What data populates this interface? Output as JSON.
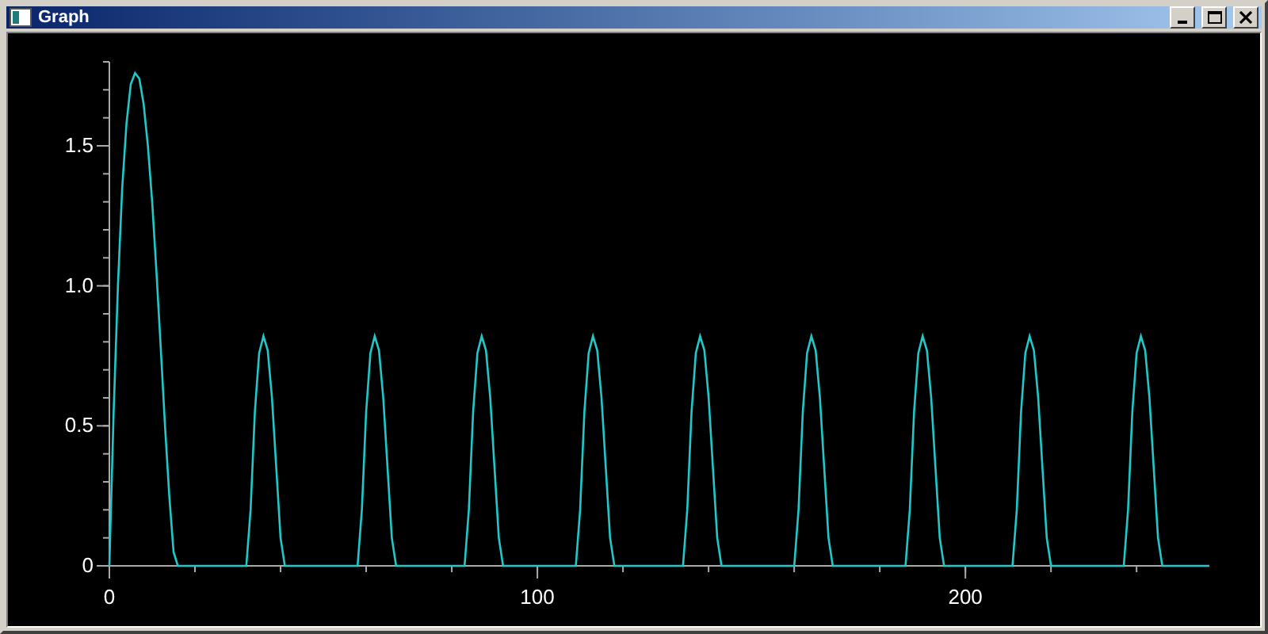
{
  "window": {
    "title": "Graph"
  },
  "graph": {
    "chart_data": {
      "type": "line",
      "xlim": [
        0,
        257
      ],
      "ylim": [
        0,
        1.8
      ],
      "xticks": [
        0,
        100,
        200
      ],
      "yticks": [
        0,
        {
          "value": 0.5,
          "label": "0.5"
        },
        {
          "value": 1,
          "label": "1.0"
        },
        {
          "value": 1.5,
          "label": "1.5"
        }
      ],
      "x": [
        0,
        1,
        2,
        3,
        4,
        5,
        6,
        7,
        8,
        9,
        10,
        11,
        12,
        13,
        14,
        15,
        16,
        17,
        18,
        19,
        20,
        21,
        22,
        23,
        24,
        25,
        26,
        27,
        28,
        29,
        30,
        31,
        32,
        33,
        34,
        35,
        36,
        37,
        38,
        39,
        40,
        41,
        42,
        43,
        44,
        45,
        46,
        47,
        48,
        49,
        50,
        51,
        52,
        53,
        54,
        55,
        56,
        57,
        58,
        59,
        60,
        61,
        62,
        63,
        64,
        65,
        66,
        67,
        68,
        69,
        70,
        71,
        72,
        73,
        74,
        75,
        76,
        77,
        78,
        79,
        80,
        81,
        82,
        83,
        84,
        85,
        86,
        87,
        88,
        89,
        90,
        91,
        92,
        93,
        94,
        95,
        96,
        97,
        98,
        99,
        100,
        101,
        102,
        103,
        104,
        105,
        106,
        107,
        108,
        109,
        110,
        111,
        112,
        113,
        114,
        115,
        116,
        117,
        118,
        119,
        120,
        121,
        122,
        123,
        124,
        125,
        126,
        127,
        128,
        129,
        130,
        131,
        132,
        133,
        134,
        135,
        136,
        137,
        138,
        139,
        140,
        141,
        142,
        143,
        144,
        145,
        146,
        147,
        148,
        149,
        150,
        151,
        152,
        153,
        154,
        155,
        156,
        157,
        158,
        159,
        160,
        161,
        162,
        163,
        164,
        165,
        166,
        167,
        168,
        169,
        170,
        171,
        172,
        173,
        174,
        175,
        176,
        177,
        178,
        179,
        180,
        181,
        182,
        183,
        184,
        185,
        186,
        187,
        188,
        189,
        190,
        191,
        192,
        193,
        194,
        195,
        196,
        197,
        198,
        199,
        200,
        201,
        202,
        203,
        204,
        205,
        206,
        207,
        208,
        209,
        210,
        211,
        212,
        213,
        214,
        215,
        216,
        217,
        218,
        219,
        220,
        221,
        222,
        223,
        224,
        225,
        226,
        227,
        228,
        229,
        230,
        231,
        232,
        233,
        234,
        235,
        236,
        237,
        238,
        239,
        240,
        241,
        242,
        243,
        244,
        245,
        246,
        247,
        248,
        249,
        250,
        251,
        252,
        253,
        254,
        255,
        256,
        257
      ],
      "series": [
        {
          "color": "#20c8c8",
          "values": [
            0,
            0.55,
            1,
            1.35,
            1.58,
            1.72,
            1.76,
            1.74,
            1.65,
            1.5,
            1.3,
            1.05,
            0.78,
            0.5,
            0.25,
            0.05,
            0,
            0,
            0,
            0,
            0,
            0,
            0,
            0,
            0,
            0,
            0,
            0,
            0,
            0,
            0,
            0,
            0,
            0.2,
            0.55,
            0.76,
            0.82,
            0.77,
            0.6,
            0.35,
            0.1,
            0,
            0,
            0,
            0,
            0,
            0,
            0,
            0,
            0,
            0,
            0,
            0,
            0,
            0,
            0,
            0,
            0,
            0,
            0.2,
            0.55,
            0.76,
            0.82,
            0.77,
            0.6,
            0.35,
            0.1,
            0,
            0,
            0,
            0,
            0,
            0,
            0,
            0,
            0,
            0,
            0,
            0,
            0,
            0,
            0,
            0,
            0,
            0.2,
            0.55,
            0.76,
            0.82,
            0.77,
            0.6,
            0.35,
            0.1,
            0,
            0,
            0,
            0,
            0,
            0,
            0,
            0,
            0,
            0,
            0,
            0,
            0,
            0,
            0,
            0,
            0,
            0,
            0.2,
            0.55,
            0.76,
            0.82,
            0.77,
            0.6,
            0.35,
            0.1,
            0,
            0,
            0,
            0,
            0,
            0,
            0,
            0,
            0,
            0,
            0,
            0,
            0,
            0,
            0,
            0,
            0,
            0.2,
            0.55,
            0.76,
            0.82,
            0.77,
            0.6,
            0.35,
            0.1,
            0,
            0,
            0,
            0,
            0,
            0,
            0,
            0,
            0,
            0,
            0,
            0,
            0,
            0,
            0,
            0,
            0,
            0,
            0.2,
            0.55,
            0.76,
            0.82,
            0.77,
            0.6,
            0.35,
            0.1,
            0,
            0,
            0,
            0,
            0,
            0,
            0,
            0,
            0,
            0,
            0,
            0,
            0,
            0,
            0,
            0,
            0,
            0,
            0.2,
            0.55,
            0.76,
            0.82,
            0.77,
            0.6,
            0.35,
            0.1,
            0,
            0,
            0,
            0,
            0,
            0,
            0,
            0,
            0,
            0,
            0,
            0,
            0,
            0,
            0,
            0,
            0,
            0.2,
            0.55,
            0.76,
            0.82,
            0.77,
            0.6,
            0.35,
            0.1,
            0,
            0,
            0,
            0,
            0,
            0,
            0,
            0,
            0,
            0,
            0,
            0,
            0,
            0,
            0,
            0,
            0,
            0,
            0.2,
            0.55,
            0.76,
            0.82,
            0.77,
            0.6,
            0.35,
            0.1,
            0,
            0,
            0,
            0,
            0,
            0,
            0,
            0,
            0,
            0,
            0,
            0
          ]
        }
      ]
    }
  }
}
